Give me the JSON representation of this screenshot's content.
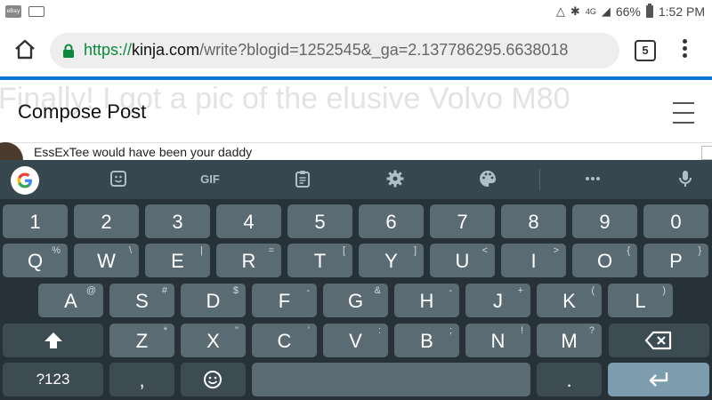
{
  "status_bar": {
    "app_icon_text": "eBay",
    "network": "4G",
    "battery": "66%",
    "time": "1:52 PM"
  },
  "browser": {
    "url_scheme": "https://",
    "url_host": "kinja.com",
    "url_path": "/write?blogid=1252545&_ga=2.137786295.6638018",
    "tab_count": "5",
    "accent_color": "#0b74d4"
  },
  "page": {
    "ghost_title": "Finally! I got a pic of the elusive Volvo M80",
    "header_title": "Compose Post",
    "comment_text": "EssExTee would have been your daddy"
  },
  "keyboard": {
    "toolbar": [
      "google-icon",
      "sticker-icon",
      "GIF",
      "clipboard-icon",
      "settings-icon",
      "palette-icon",
      "more-icon",
      "mic-icon"
    ],
    "gif_label": "GIF",
    "row_numbers": [
      {
        "label": "1"
      },
      {
        "label": "2"
      },
      {
        "label": "3"
      },
      {
        "label": "4"
      },
      {
        "label": "5"
      },
      {
        "label": "6"
      },
      {
        "label": "7"
      },
      {
        "label": "8"
      },
      {
        "label": "9"
      },
      {
        "label": "0"
      }
    ],
    "row_1": [
      {
        "label": "Q",
        "hint": "%"
      },
      {
        "label": "W",
        "hint": "\\"
      },
      {
        "label": "E",
        "hint": "|"
      },
      {
        "label": "R",
        "hint": "="
      },
      {
        "label": "T",
        "hint": "["
      },
      {
        "label": "Y",
        "hint": "]"
      },
      {
        "label": "U",
        "hint": "<"
      },
      {
        "label": "I",
        "hint": ">"
      },
      {
        "label": "O",
        "hint": "{"
      },
      {
        "label": "P",
        "hint": "}"
      }
    ],
    "row_2": [
      {
        "label": "A",
        "hint": "@"
      },
      {
        "label": "S",
        "hint": "#"
      },
      {
        "label": "D",
        "hint": "$"
      },
      {
        "label": "F",
        "hint": "-"
      },
      {
        "label": "G",
        "hint": "&"
      },
      {
        "label": "H",
        "hint": "-"
      },
      {
        "label": "J",
        "hint": "+"
      },
      {
        "label": "K",
        "hint": "("
      },
      {
        "label": "L",
        "hint": ")"
      }
    ],
    "row_3": [
      {
        "label": "Z",
        "hint": "*"
      },
      {
        "label": "X",
        "hint": "\""
      },
      {
        "label": "C",
        "hint": "'"
      },
      {
        "label": "V",
        "hint": ":"
      },
      {
        "label": "B",
        "hint": ";"
      },
      {
        "label": "N",
        "hint": "!"
      },
      {
        "label": "M",
        "hint": "?"
      }
    ],
    "row_4": {
      "symbols": "?123",
      "comma": ",",
      "period": "."
    }
  }
}
